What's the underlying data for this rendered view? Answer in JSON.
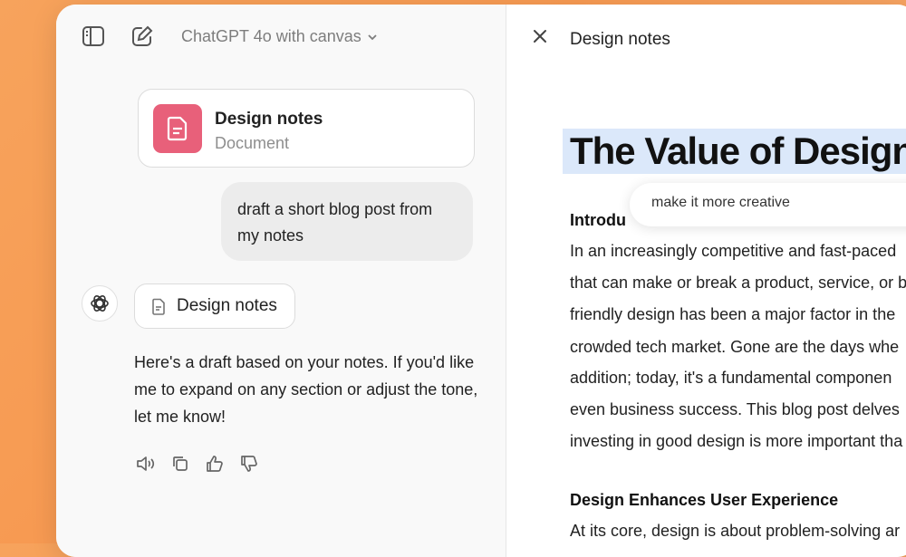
{
  "header": {
    "model_label": "ChatGPT 4o with canvas"
  },
  "conversation": {
    "doc_card": {
      "title": "Design notes",
      "subtitle": "Document"
    },
    "user_message": [
      "draft a short blog post from",
      "my notes"
    ],
    "doc_chip": {
      "label": "Design notes"
    },
    "assistant_reply": [
      "Here's a draft based on your notes. If you'd like",
      "me to expand on any section or adjust the tone,",
      "let me know!"
    ]
  },
  "canvas": {
    "title": "Design notes",
    "headline": "The Value of Design",
    "prompt_text": "make it more creative",
    "intro_heading": "Introdu",
    "intro_lines": [
      "In an increasingly competitive and fast-paced",
      "that can make or break a product, service, or b",
      "friendly design has been a major factor in the",
      "crowded tech market. Gone are the days whe",
      "addition; today, it's a fundamental componen",
      "even business success. This blog post delves",
      "investing in good design is more important tha"
    ],
    "section2_heading": "Design Enhances User Experience",
    "section2_lines": [
      "At its core, design is about problem-solving ar"
    ]
  },
  "colors": {
    "accent_doc": "#e8607a",
    "highlight": "#dbe8fa",
    "user_bubble": "#ececec"
  }
}
